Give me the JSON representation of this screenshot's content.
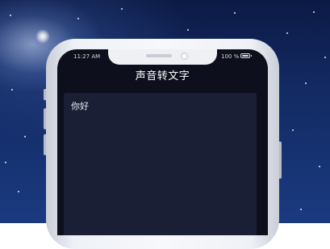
{
  "status_bar": {
    "time": "11:27 AM",
    "battery": "100 %",
    "battery_level": 1.0
  },
  "app": {
    "title": "声音转文字"
  },
  "transcript": {
    "text": "你好"
  }
}
